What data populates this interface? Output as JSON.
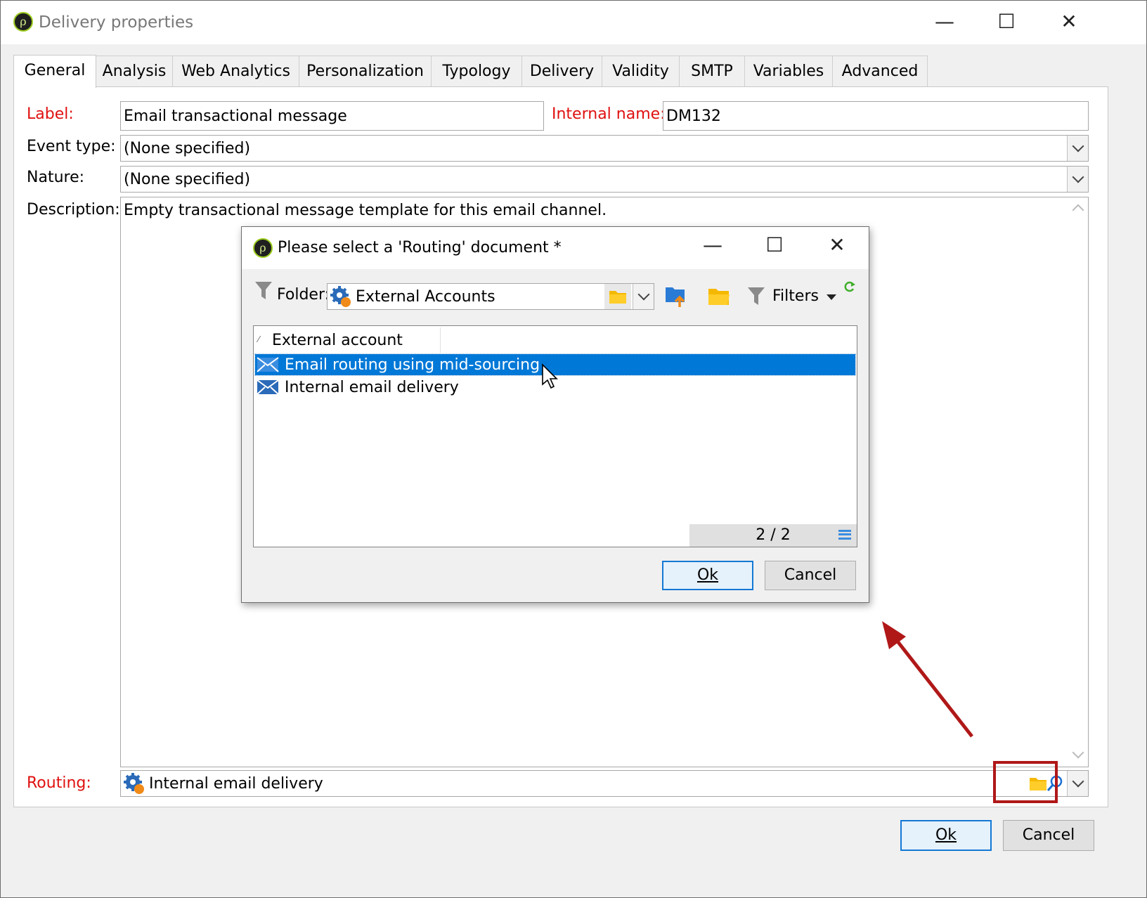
{
  "window": {
    "title": "Delivery properties",
    "tabs": [
      "General",
      "Analysis",
      "Web Analytics",
      "Personalization",
      "Typology",
      "Delivery",
      "Validity",
      "SMTP",
      "Variables",
      "Advanced"
    ],
    "active_tab": "General"
  },
  "form": {
    "label_label": "Label:",
    "label_value": "Email transactional message",
    "internal_name_label": "Internal name:",
    "internal_name_value": "DM132",
    "event_type_label": "Event type:",
    "event_type_value": "(None specified)",
    "nature_label": "Nature:",
    "nature_value": "(None specified)",
    "description_label": "Description:",
    "description_value": "Empty transactional message template for this email channel.",
    "routing_label": "Routing:",
    "routing_value": "Internal email delivery"
  },
  "footer": {
    "ok": "Ok",
    "cancel": "Cancel"
  },
  "dialog": {
    "title": "Please select a 'Routing' document *",
    "folder_label": "Folder:",
    "folder_value": "External Accounts",
    "filters_label": "Filters",
    "column_header": "External account",
    "rows": [
      "Email routing using mid-sourcing",
      "Internal email delivery"
    ],
    "selected_index": 0,
    "count": "2 / 2",
    "ok": "Ok",
    "cancel": "Cancel"
  },
  "colors": {
    "required": "#e01010",
    "selection": "#0078d7",
    "highlight_box": "#b01818",
    "arrow": "#b01818"
  }
}
